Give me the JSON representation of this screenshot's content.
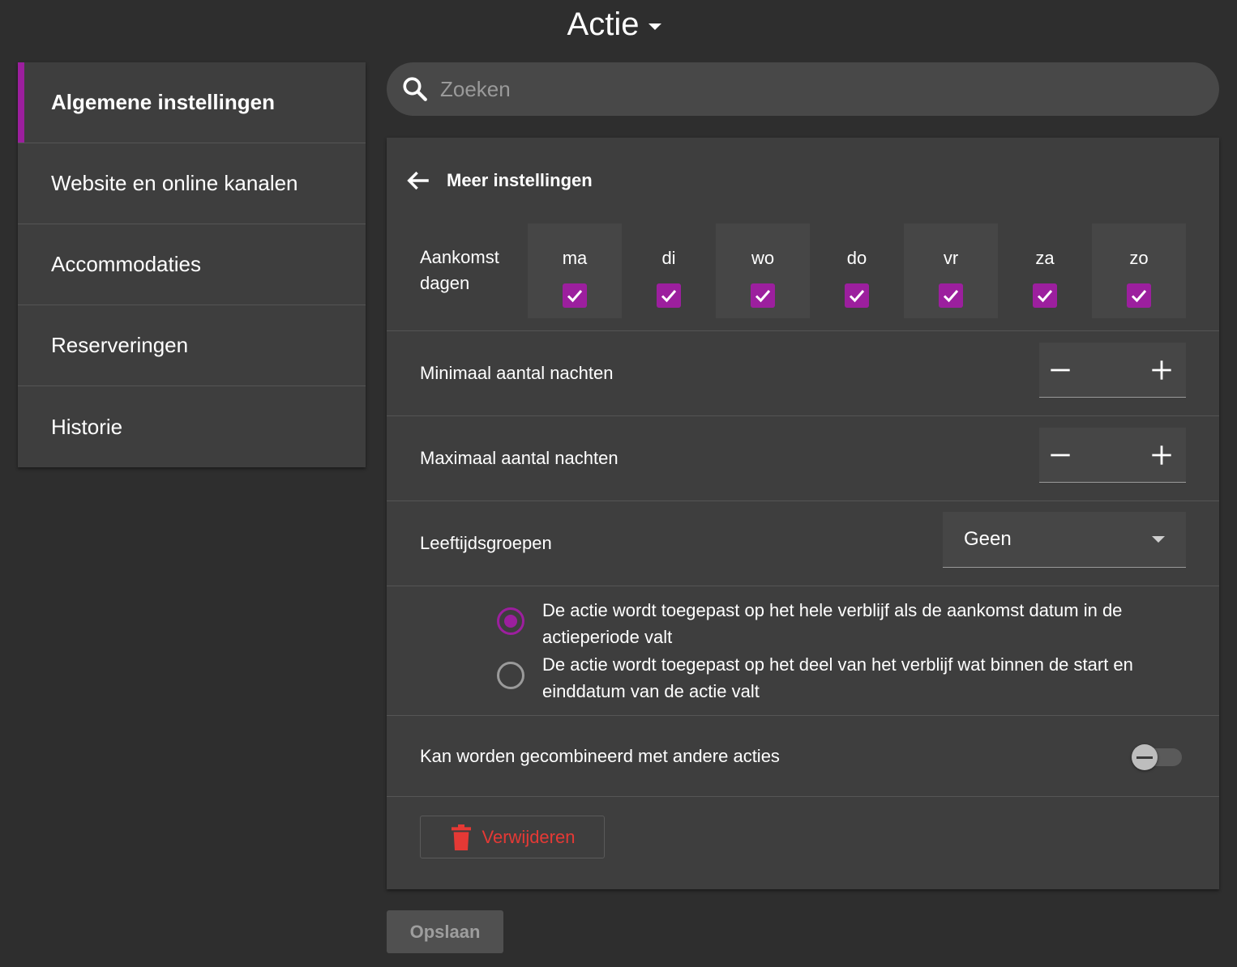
{
  "title": "Actie",
  "sidebar": {
    "items": [
      {
        "label": "Algemene instellingen",
        "active": true
      },
      {
        "label": "Website en online kanalen",
        "active": false
      },
      {
        "label": "Accommodaties",
        "active": false
      },
      {
        "label": "Reserveringen",
        "active": false
      },
      {
        "label": "Historie",
        "active": false
      }
    ]
  },
  "search": {
    "placeholder": "Zoeken",
    "value": ""
  },
  "card": {
    "header_title": "Meer instellingen",
    "arrival_days": {
      "label_line1": "Aankomst",
      "label_line2": "dagen",
      "days": [
        {
          "name": "ma",
          "checked": true
        },
        {
          "name": "di",
          "checked": true
        },
        {
          "name": "wo",
          "checked": true
        },
        {
          "name": "do",
          "checked": true
        },
        {
          "name": "vr",
          "checked": true
        },
        {
          "name": "za",
          "checked": true
        },
        {
          "name": "zo",
          "checked": true
        }
      ]
    },
    "min_nights": {
      "label": "Minimaal aantal nachten",
      "value": ""
    },
    "max_nights": {
      "label": "Maximaal aantal nachten",
      "value": ""
    },
    "age_groups": {
      "label": "Leeftijdsgroepen",
      "selected": "Geen"
    },
    "apply_options": [
      {
        "text": "De actie wordt toegepast op het hele verblijf als de aankomst datum in de actieperiode valt",
        "checked": true
      },
      {
        "text": "De actie wordt toegepast op het deel van het verblijf wat binnen de start en einddatum van de actie valt",
        "checked": false
      }
    ],
    "combinable": {
      "label": "Kan worden gecombineerd met andere acties",
      "on": false
    },
    "delete_label": "Verwijderen"
  },
  "save_label": "Opslaan",
  "colors": {
    "accent": "#9c1f9e",
    "danger": "#e53935",
    "background": "#2e2e2e",
    "panel": "#3e3e3e"
  }
}
